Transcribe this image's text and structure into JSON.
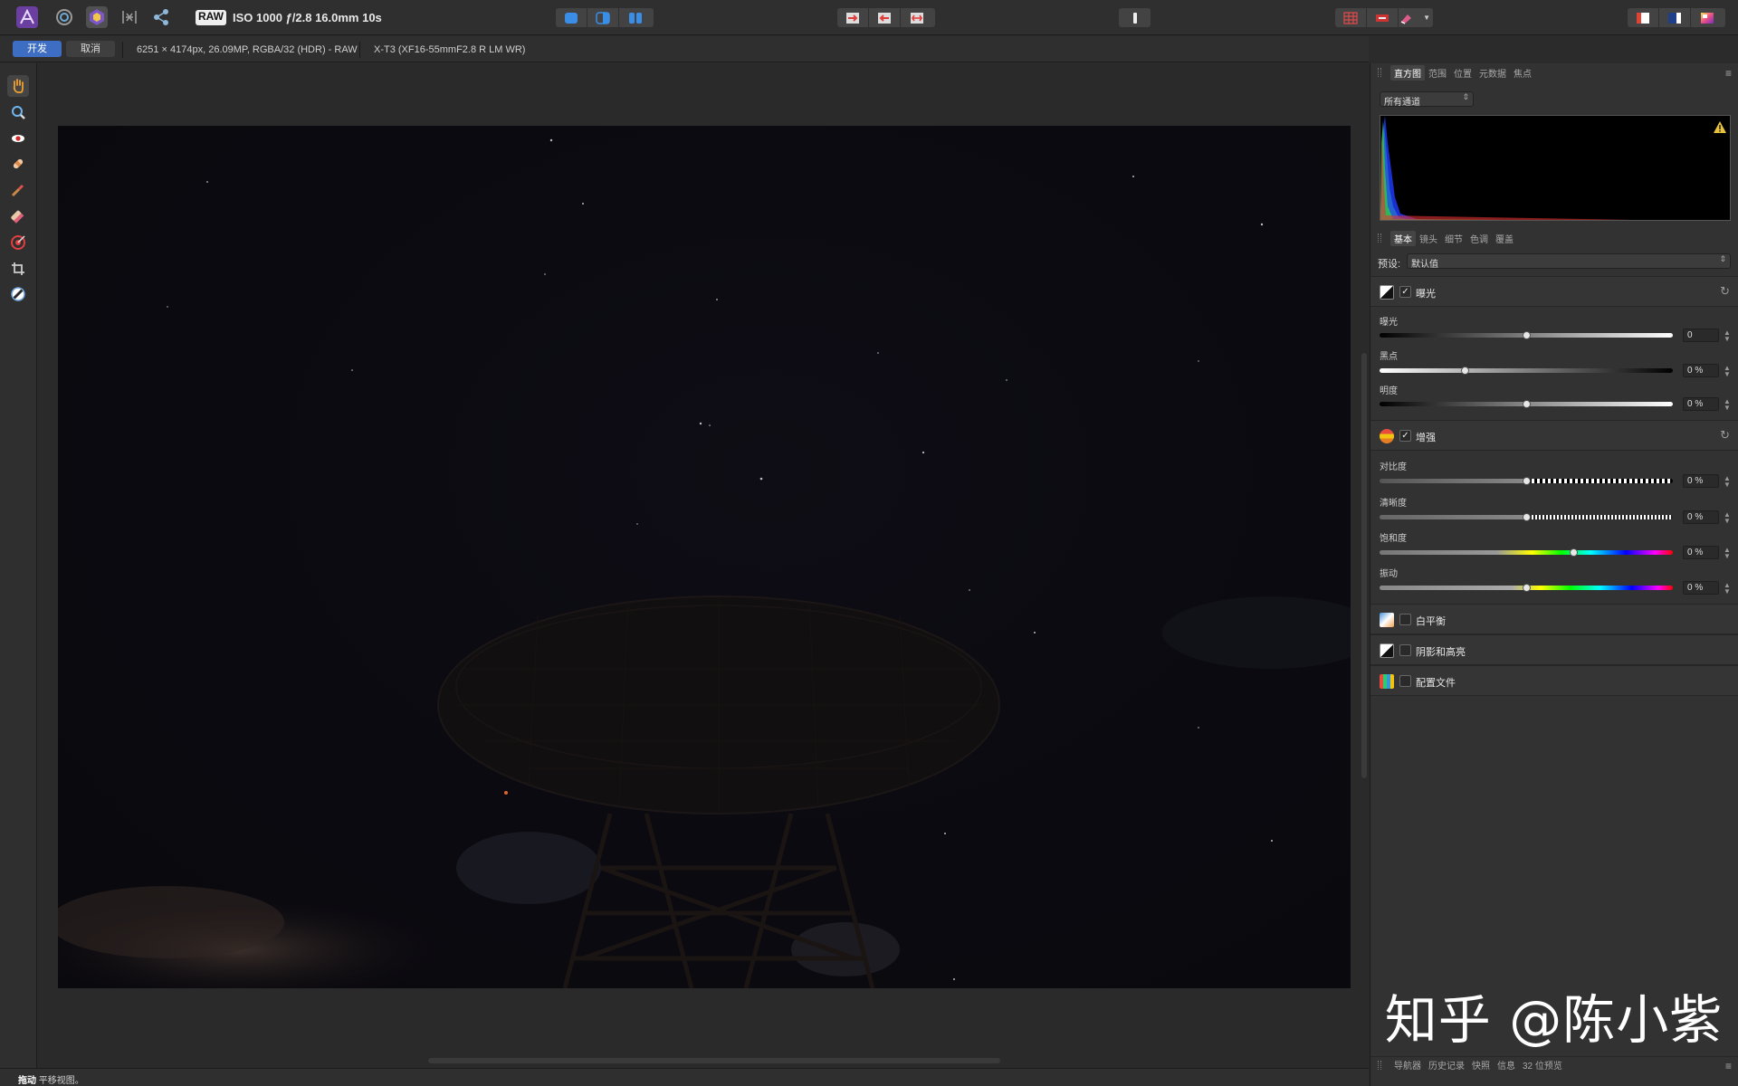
{
  "toolbar": {
    "raw_badge": "RAW",
    "exif": "ISO 1000 ƒ/2.8 16.0mm 10s",
    "accent_color": "#3d6ec4"
  },
  "context": {
    "develop_label": "开发",
    "cancel_label": "取消",
    "image_info": "6251 × 4174px, 26.09MP, RGBA/32 (HDR) - RAW",
    "lens_info": "X-T3 (XF16-55mmF2.8 R LM WR)"
  },
  "status": {
    "action": "拖动",
    "hint": "平移视图。"
  },
  "top_tabs": [
    "直方图",
    "范围",
    "位置",
    "元数据",
    "焦点"
  ],
  "histogram": {
    "channel": "所有通道",
    "warning_icon": "warning-triangle-icon"
  },
  "develop_tabs": [
    "基本",
    "镜头",
    "细节",
    "色调",
    "覆盖"
  ],
  "preset": {
    "label": "预设:",
    "value": "默认值"
  },
  "exposure_section": {
    "title": "曝光",
    "enabled": true,
    "sliders": [
      {
        "label": "曝光",
        "value": "0",
        "position": 0.5
      },
      {
        "label": "黑点",
        "value": "0 %",
        "position": 0.29
      },
      {
        "label": "明度",
        "value": "0 %",
        "position": 0.5
      }
    ]
  },
  "enhance_section": {
    "title": "增强",
    "enabled": true,
    "sliders": [
      {
        "label": "对比度",
        "value": "0 %",
        "position": 0.5
      },
      {
        "label": "清晰度",
        "value": "0 %",
        "position": 0.5
      },
      {
        "label": "饱和度",
        "value": "0 %",
        "position": 0.66
      },
      {
        "label": "振动",
        "value": "0 %",
        "position": 0.5
      }
    ]
  },
  "collapsed_sections": [
    {
      "title": "白平衡"
    },
    {
      "title": "阴影和高亮"
    },
    {
      "title": "配置文件"
    }
  ],
  "bottom_tabs": [
    "导航器",
    "历史记录",
    "快照",
    "信息",
    "32 位预览"
  ],
  "watermark": "知乎 @陈小紫"
}
